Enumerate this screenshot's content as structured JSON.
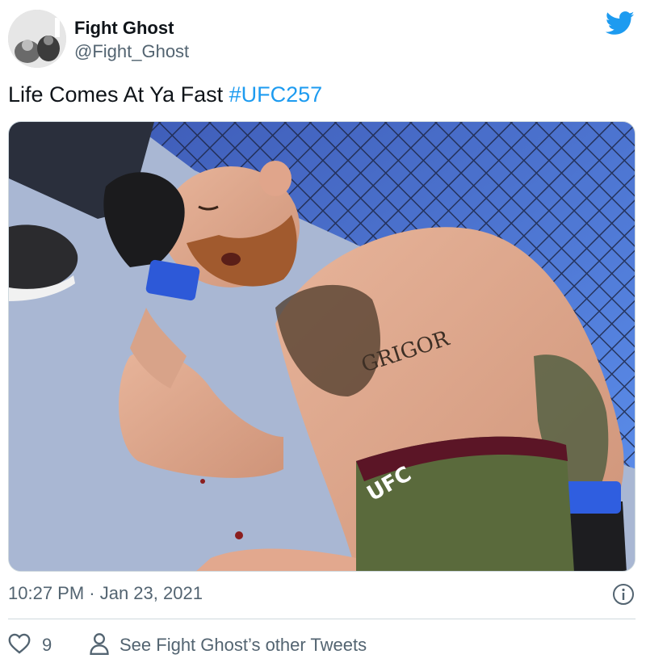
{
  "author": {
    "display_name": "Fight Ghost",
    "handle": "@Fight_Ghost"
  },
  "tweet": {
    "text": "Life Comes At Ya Fast",
    "hashtag": "#UFC257",
    "timestamp": "10:27 PM · Jan 23, 2021"
  },
  "actions": {
    "like_count": "9",
    "profile_link": "See Fight Ghost’s other Tweets"
  },
  "media": {
    "tattoo_text": "GRIGOR",
    "shorts_brand": "UFC"
  },
  "colors": {
    "accent": "#1d9bf0",
    "text_primary": "#0f1419",
    "text_secondary": "#536471",
    "divider": "#cfd9de"
  },
  "icons": [
    "twitter-bird-icon",
    "info-icon",
    "heart-icon",
    "person-icon"
  ]
}
